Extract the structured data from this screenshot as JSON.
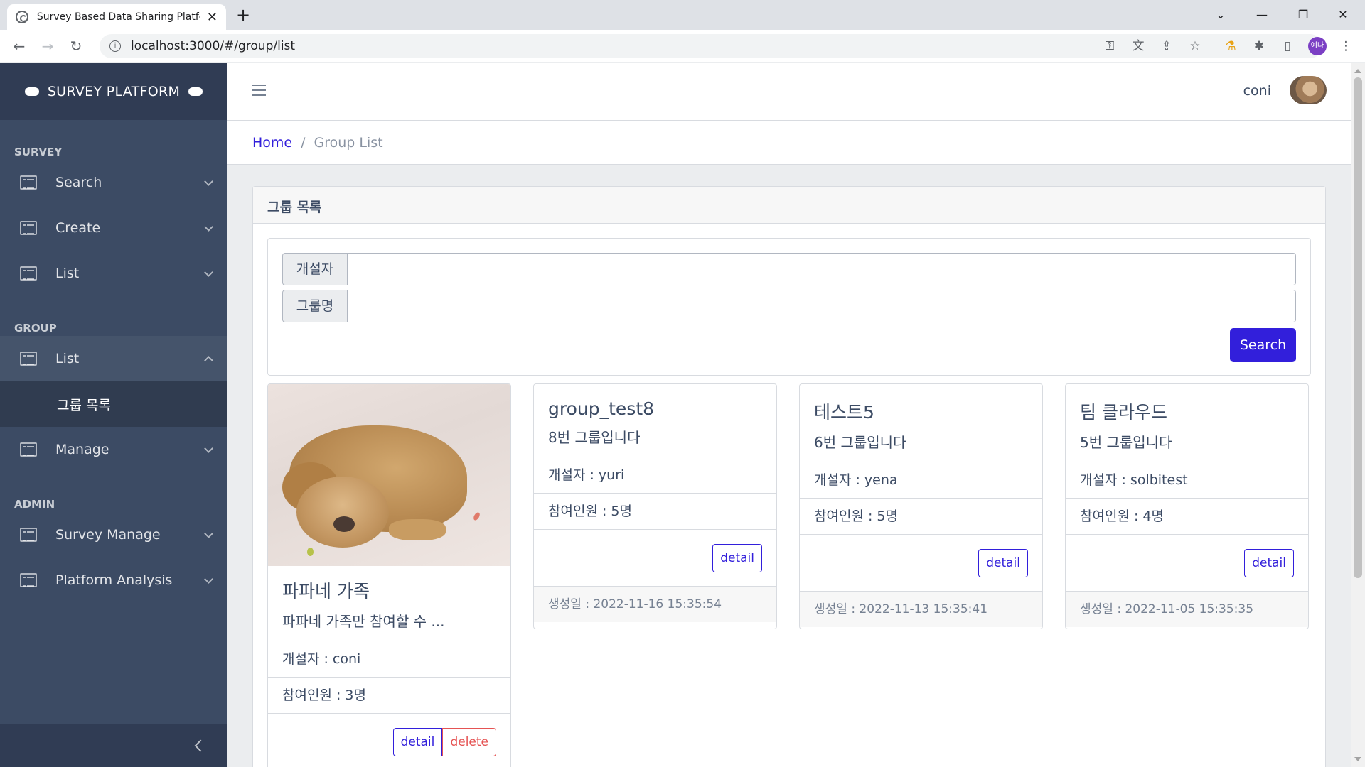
{
  "browser": {
    "tab_title": "Survey Based Data Sharing Platform",
    "url": "localhost:3000/#/group/list",
    "profile_label": "예나"
  },
  "sidebar": {
    "brand": "SURVEY PLATFORM",
    "sections": {
      "survey": "SURVEY",
      "group": "GROUP",
      "admin": "ADMIN"
    },
    "items": {
      "survey_search": "Search",
      "survey_create": "Create",
      "survey_list": "List",
      "group_list": "List",
      "group_list_sub": "그룹 목록",
      "group_manage": "Manage",
      "survey_manage": "Survey Manage",
      "platform_analysis": "Platform Analysis"
    }
  },
  "header": {
    "username": "coni"
  },
  "breadcrumb": {
    "home": "Home",
    "separator": "/",
    "current": "Group List"
  },
  "main": {
    "title": "그룹 목록",
    "search": {
      "creator_label": "개설자",
      "creator_value": "",
      "name_label": "그룹명",
      "name_value": "",
      "button": "Search"
    }
  },
  "groups": [
    {
      "name": "파파네 가족",
      "desc": "파파네 가족만 참여할 수 ...",
      "creator": "개설자 : coni",
      "members": "참여인원 : 3명",
      "detail": "detail",
      "delete": "delete"
    },
    {
      "name": "group_test8",
      "desc": "8번 그룹입니다",
      "creator": "개설자 : yuri",
      "members": "참여인원 : 5명",
      "detail": "detail",
      "created": "생성일 : 2022-11-16 15:35:54"
    },
    {
      "name": "테스트5",
      "desc": "6번 그룹입니다",
      "creator": "개설자 : yena",
      "members": "참여인원 : 5명",
      "detail": "detail",
      "created": "생성일 : 2022-11-13 15:35:41"
    },
    {
      "name": "팀 클라우드",
      "desc": "5번 그룹입니다",
      "creator": "개설자 : solbitest",
      "members": "참여인원 : 4명",
      "detail": "detail",
      "created": "생성일 : 2022-11-05 15:35:35"
    }
  ],
  "colors": {
    "sidebar_bg": "#3c4b64",
    "primary": "#321fdb",
    "danger": "#e55353"
  }
}
